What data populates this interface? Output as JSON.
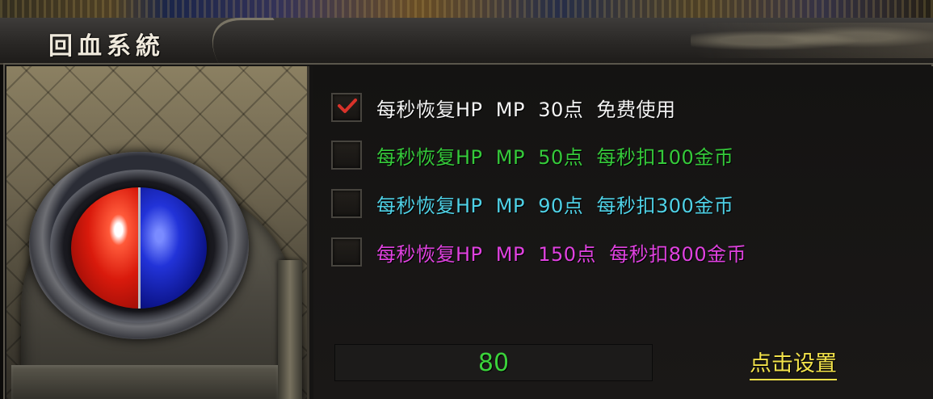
{
  "window": {
    "title": "回血系統"
  },
  "options": [
    {
      "label": "每秒恢复HP  MP  30点  免费使用",
      "checked": true,
      "color": "#f4f4f4"
    },
    {
      "label": "每秒恢复HP  MP  50点  每秒扣100金币",
      "checked": false,
      "color": "#35c93a"
    },
    {
      "label": "每秒恢复HP  MP  90点  每秒扣300金币",
      "checked": false,
      "color": "#4fd1e6"
    },
    {
      "label": "每秒恢复HP  MP  150点  每秒扣800金币",
      "checked": false,
      "color": "#e042e0"
    }
  ],
  "value_input": {
    "value": "80",
    "color": "#3bd23b"
  },
  "settings_button": {
    "label": "点击设置",
    "color": "#f2e24a"
  },
  "check_color": "#d8322a",
  "icons": {
    "orb": "hp-mp-orb-icon",
    "check": "checkmark-icon"
  }
}
